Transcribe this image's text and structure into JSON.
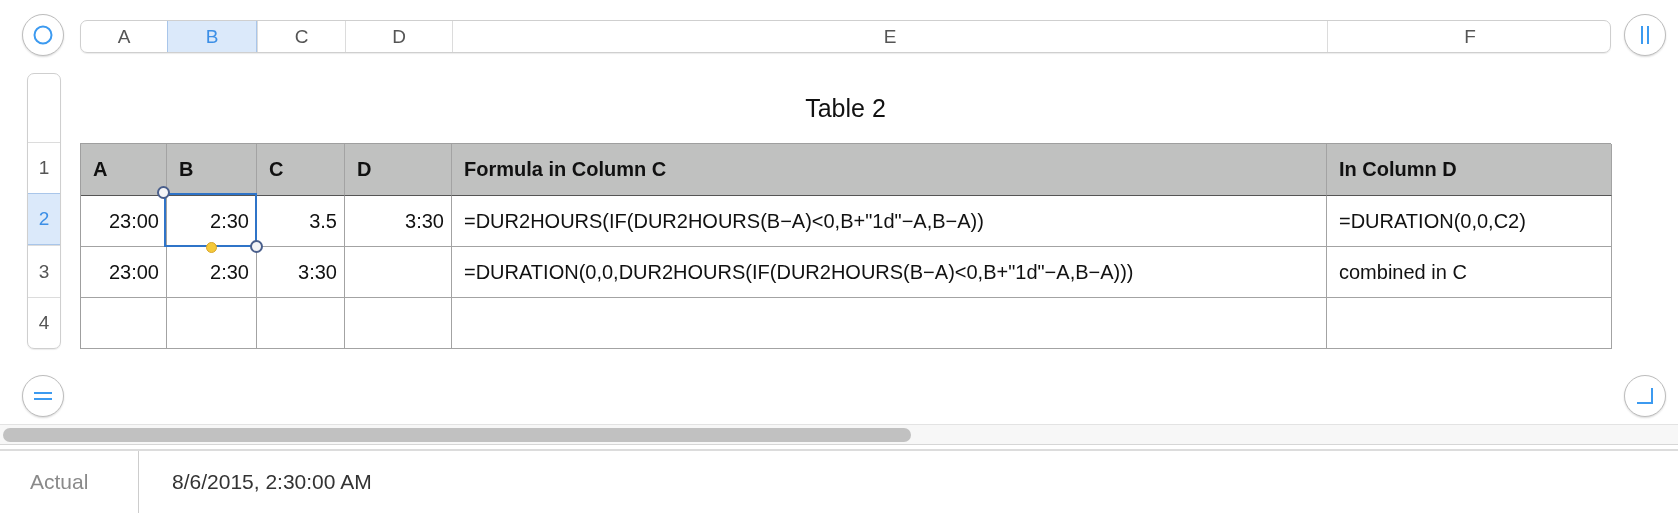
{
  "column_headers": [
    {
      "label": "A",
      "selected": false
    },
    {
      "label": "B",
      "selected": true
    },
    {
      "label": "C",
      "selected": false
    },
    {
      "label": "D",
      "selected": false
    },
    {
      "label": "E",
      "selected": false
    },
    {
      "label": "F",
      "selected": false
    }
  ],
  "row_headers": [
    {
      "label": "1",
      "selected": false
    },
    {
      "label": "2",
      "selected": true
    },
    {
      "label": "3",
      "selected": false
    },
    {
      "label": "4",
      "selected": false
    }
  ],
  "table": {
    "title": "Table 2",
    "rows": [
      {
        "kind": "header",
        "cells": [
          {
            "text": "A",
            "selected": false
          },
          {
            "text": "B",
            "selected": false
          },
          {
            "text": "C",
            "selected": false
          },
          {
            "text": "D",
            "selected": false
          },
          {
            "text": "Formula in Column C",
            "selected": false
          },
          {
            "text": "In Column D",
            "selected": false
          }
        ]
      },
      {
        "kind": "body",
        "cells": [
          {
            "text": "23:00",
            "selected": false
          },
          {
            "text": "2:30",
            "selected": true
          },
          {
            "text": "3.5",
            "selected": false
          },
          {
            "text": "3:30",
            "selected": false
          },
          {
            "text": "=DUR2HOURS(IF(DUR2HOURS(B−A)<0,B+\"1d\"−A,B−A))",
            "selected": false
          },
          {
            "text": "=DURATION(0,0,C2)",
            "selected": false
          }
        ]
      },
      {
        "kind": "body",
        "cells": [
          {
            "text": "23:00",
            "selected": false
          },
          {
            "text": "2:30",
            "selected": false
          },
          {
            "text": "3:30",
            "selected": false
          },
          {
            "selected": false
          },
          {
            "text": "=DURATION(0,0,DUR2HOURS(IF(DUR2HOURS(B−A)<0,B+\"1d\"−A,B−A)))",
            "selected": false
          },
          {
            "text": "combined in C",
            "selected": false
          }
        ]
      },
      {
        "kind": "body",
        "cells": [
          {
            "selected": false
          },
          {
            "selected": false
          },
          {
            "selected": false
          },
          {
            "selected": false
          },
          {
            "selected": false
          },
          {
            "selected": false
          }
        ]
      }
    ]
  },
  "status_bar": {
    "label": "Actual",
    "value": "8/6/2015, 2:30:00 AM"
  }
}
